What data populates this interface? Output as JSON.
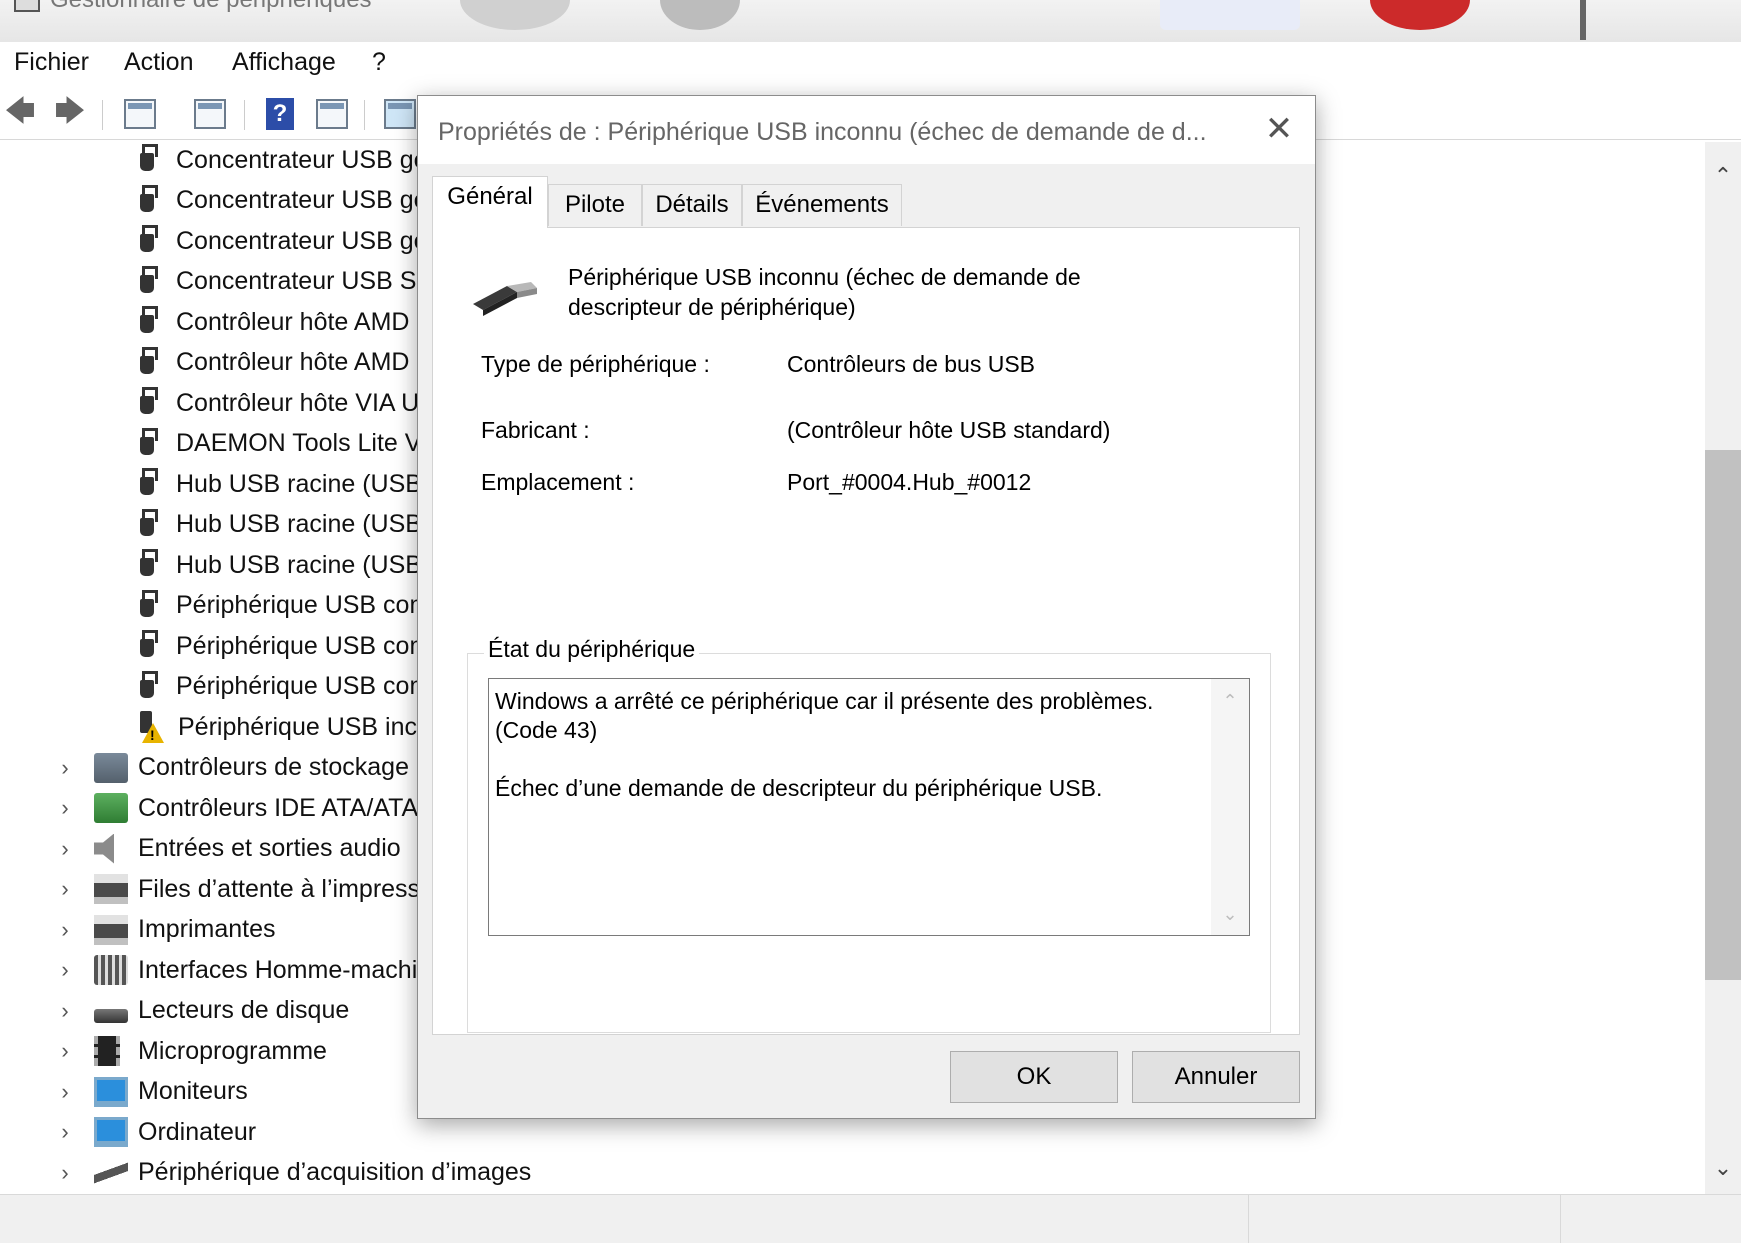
{
  "window": {
    "title": "Gestionnaire de périphériques",
    "menu": [
      "Fichier",
      "Action",
      "Affichage",
      "?"
    ]
  },
  "tree": {
    "usb_devices": [
      "Concentrateur USB gé",
      "Concentrateur USB gé",
      "Concentrateur USB gé",
      "Concentrateur USB Su",
      "Contrôleur hôte AMD",
      "Contrôleur hôte AMD",
      "Contrôleur hôte VIA U",
      "DAEMON Tools Lite V",
      "Hub USB racine (USB",
      "Hub USB racine (USB",
      "Hub USB racine (USB",
      "Périphérique USB com",
      "Périphérique USB com",
      "Périphérique USB com"
    ],
    "problem_device": "Périphérique USB inc",
    "categories": [
      {
        "label": "Contrôleurs de stockage",
        "icon": "storage-icon"
      },
      {
        "label": "Contrôleurs IDE ATA/ATAPI",
        "icon": "ide-icon"
      },
      {
        "label": "Entrées et sorties audio",
        "icon": "audio-icon"
      },
      {
        "label": "Files d’attente à l’impression",
        "icon": "print-queue-icon"
      },
      {
        "label": "Imprimantes",
        "icon": "printer-icon"
      },
      {
        "label": "Interfaces Homme-machine",
        "icon": "hid-icon"
      },
      {
        "label": "Lecteurs de disque",
        "icon": "disk-drive-icon"
      },
      {
        "label": "Microprogramme",
        "icon": "firmware-icon"
      },
      {
        "label": "Moniteurs",
        "icon": "monitor-icon"
      },
      {
        "label": "Ordinateur",
        "icon": "computer-icon"
      },
      {
        "label": "Périphérique d’acquisition d’images",
        "icon": "imaging-icon"
      }
    ]
  },
  "dialog": {
    "title": "Propriétés de : Périphérique USB inconnu (échec de demande de d...",
    "tabs": [
      "Général",
      "Pilote",
      "Détails",
      "Événements"
    ],
    "active_tab": "Général",
    "device_name": "Périphérique USB inconnu (échec de demande de descripteur de périphérique)",
    "props": {
      "type_label": "Type de périphérique :",
      "type_value": "Contrôleurs de bus USB",
      "maker_label": "Fabricant :",
      "maker_value": "(Contrôleur hôte USB standard)",
      "location_label": "Emplacement :",
      "location_value": "Port_#0004.Hub_#0012"
    },
    "status": {
      "group_label": "État du périphérique",
      "text": "Windows a arrêté ce périphérique car il présente des problèmes. (Code 43)\n\nÉchec d’une demande de descripteur du périphérique USB."
    },
    "buttons": {
      "ok": "OK",
      "cancel": "Annuler"
    }
  },
  "colors": {
    "warning": "#e8b400",
    "scroll_thumb": "#c1c1c1"
  }
}
